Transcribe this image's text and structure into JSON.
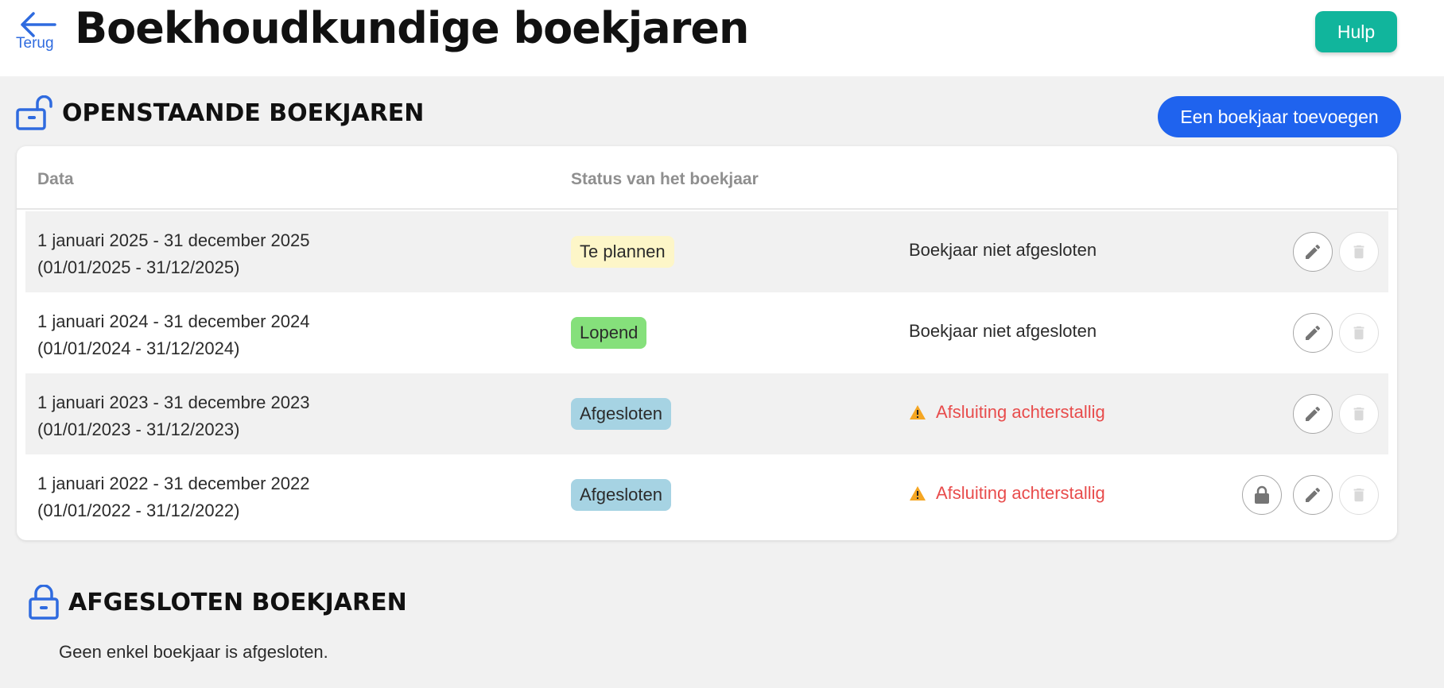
{
  "header": {
    "back_label": "Terug",
    "title": "Boekhoudkundige boekjaren",
    "help_label": "Hulp",
    "help_color": "#11b59c"
  },
  "open_section": {
    "title": "OPENSTAANDE BOEKJAREN",
    "add_label": "Een boekjaar toevoegen",
    "icon": "unlocked-padlock-icon"
  },
  "table": {
    "columns": [
      "Data",
      "Status van het boekjaar"
    ],
    "rows": [
      {
        "date_line1": "1 januari 2025 - 31 december 2025",
        "date_line2": "(01/01/2025 - 31/12/2025)",
        "status": "Te plannen",
        "state": "Boekjaar niet afgesloten"
      },
      {
        "date_line1": "1 januari 2024 - 31 december 2024",
        "date_line2": "(01/01/2024 - 31/12/2024)",
        "status": "Lopend",
        "state": "Boekjaar niet afgesloten"
      },
      {
        "date_line1": "1 januari 2023 - 31 decembre 2023",
        "date_line2": "(01/01/2023 - 31/12/2023)",
        "status": "Afgesloten",
        "state": "Afsluiting achterstallig"
      },
      {
        "date_line1": "1 januari 2022 - 31 december 2022",
        "date_line2": "(01/01/2022 - 31/12/2022)",
        "status": "Afgesloten",
        "state": "Afsluiting achterstallig"
      }
    ]
  },
  "closed_section": {
    "title": "AFGESLOTEN BOEKJAREN",
    "empty_text": "Geen enkel boekjaar is afgesloten.",
    "icon": "locked-padlock-icon"
  },
  "colors": {
    "primary": "#1f63ee",
    "warning_text": "#e84c4c",
    "badge_plan": "#fdf6c8",
    "badge_running": "#85e07b",
    "badge_closed": "#a6d3e3"
  }
}
